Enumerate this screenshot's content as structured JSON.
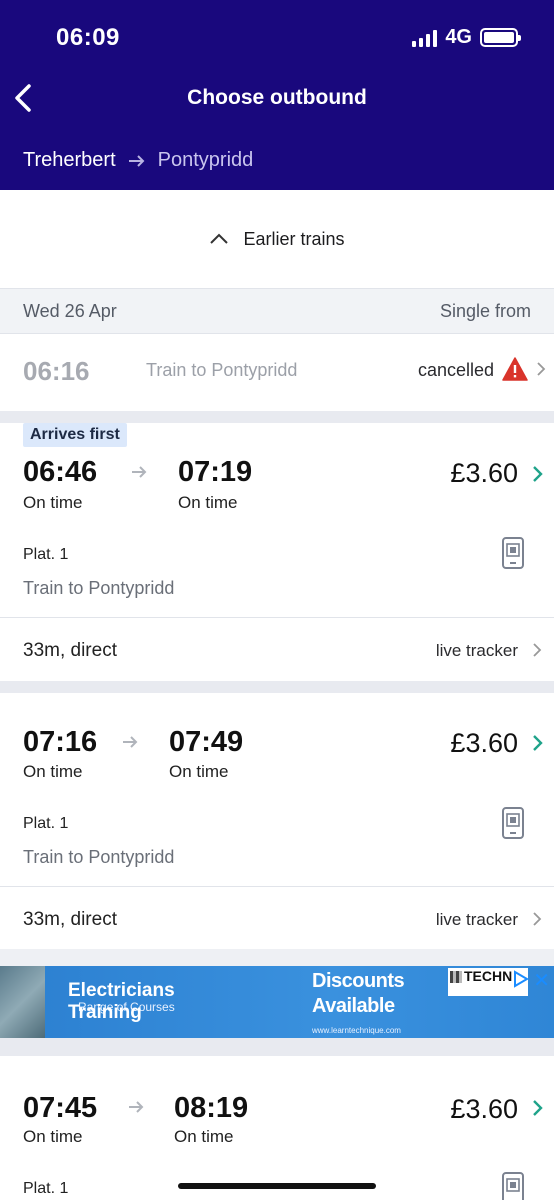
{
  "status_bar": {
    "time": "06:09",
    "network": "4G"
  },
  "header": {
    "title": "Choose outbound",
    "origin": "Treherbert",
    "destination": "Pontypridd"
  },
  "earlier_label": "Earlier trains",
  "date_row": {
    "date": "Wed 26 Apr",
    "price_header": "Single from"
  },
  "cancelled": {
    "time": "06:16",
    "destination": "Train to Pontypridd",
    "status": "cancelled"
  },
  "journeys": [
    {
      "badge": "Arrives first",
      "departure": "06:46",
      "departure_status": "On time",
      "arrival": "07:19",
      "arrival_status": "On time",
      "price": "£3.60",
      "platform": "Plat. 1",
      "destination": "Train to Pontypridd",
      "duration": "33m, direct",
      "tracker": "live tracker"
    },
    {
      "departure": "07:16",
      "departure_status": "On time",
      "arrival": "07:49",
      "arrival_status": "On time",
      "price": "£3.60",
      "platform": "Plat. 1",
      "destination": "Train to Pontypridd",
      "duration": "33m, direct",
      "tracker": "live tracker"
    },
    {
      "departure": "07:45",
      "departure_status": "On time",
      "arrival": "08:19",
      "arrival_status": "On time",
      "price": "£3.60",
      "platform": "Plat. 1"
    }
  ],
  "ad": {
    "heading": "Electricians Training",
    "subtext": "Range of Courses",
    "offer_line1": "Discounts",
    "offer_line2": "Available",
    "url": "www.learntechnique.com",
    "brand": "TECHN"
  },
  "colors": {
    "header_bg": "#19087d",
    "accent": "#1fa38a",
    "warning": "#d9342b",
    "badge_bg": "#dbe8fb"
  },
  "icons": [
    "back-chevron-icon",
    "arrow-right-icon",
    "warning-icon",
    "chevron-right-icon",
    "mobile-ticket-icon",
    "chevron-up-icon"
  ]
}
